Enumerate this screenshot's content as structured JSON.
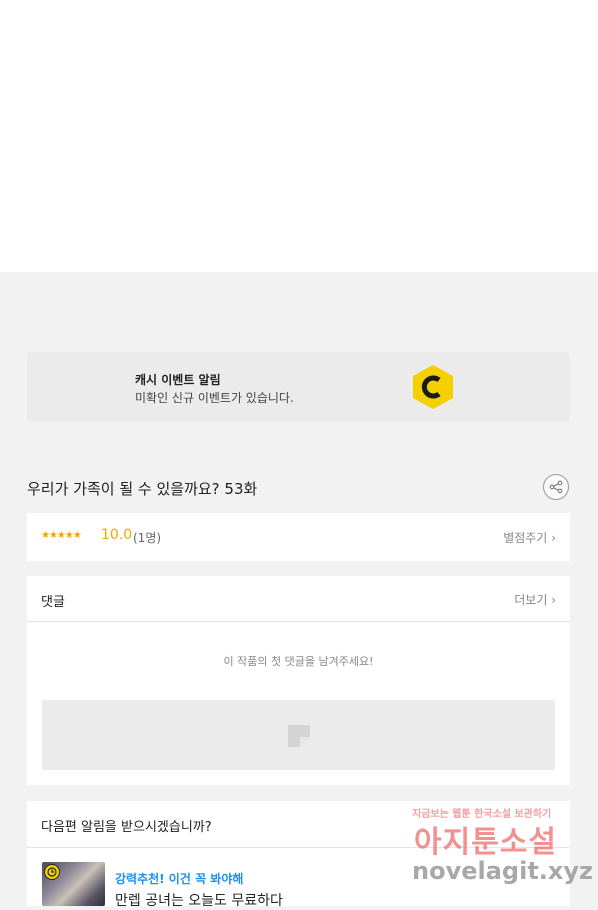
{
  "banner": {
    "title": "캐시 이벤트 알림",
    "subtitle": "미확인 신규 이벤트가 있습니다.",
    "logo_letter": "C",
    "logo_color": "#f5d000"
  },
  "episode": {
    "title": "우리가 가족이 될 수 있을까요? 53화",
    "share_icon": "share-icon"
  },
  "rating": {
    "stars": "★★★★★",
    "score": "10.0",
    "count": "(1명)",
    "action_label": "별점주기",
    "star_color": "#f2a700"
  },
  "comments": {
    "header": "댓글",
    "more_label": "더보기",
    "empty_message": "이 작품의 첫 댓글을 남겨주세요!"
  },
  "notify": {
    "question": "다음편 알림을 받으시겠습니까?",
    "recommend_label": "강력추천! 이건 꼭 봐야해",
    "recommend_title": "만렙 공녀는 오늘도 무료하다",
    "accent_color": "#1e8fe8"
  },
  "watermark": {
    "tagline": "지금보는 웹툰 한국소설 보관하기",
    "brand": "아지툰소설",
    "url": "novelagit.xyz"
  }
}
